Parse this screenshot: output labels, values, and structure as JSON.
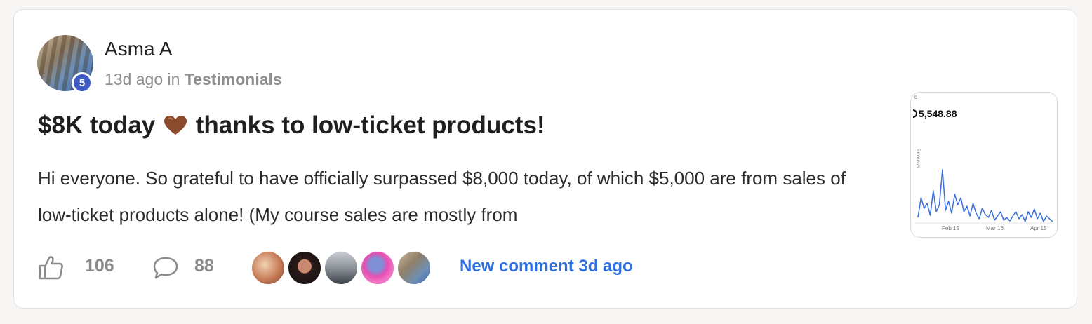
{
  "post": {
    "author": {
      "name": "Asma A",
      "level": "5",
      "icon": "avatar-photo"
    },
    "meta": {
      "time": "13d ago",
      "in": "in",
      "category": "Testimonials"
    },
    "title": {
      "before": "$8K today",
      "emoji": "brown-heart-icon",
      "after": "thanks to low-ticket products!"
    },
    "body": "Hi everyone. So grateful to have officially surpassed $8,000 today, of which $5,000 are from sales of low-ticket products alone! (My course sales are mostly from",
    "attachment": {
      "value_label": "5,548.88",
      "top_label": "e",
      "y_axis_label": "Revenue",
      "x_ticks": [
        "Feb 15",
        "Mar 16",
        "Apr 15"
      ]
    }
  },
  "footer": {
    "likes": "106",
    "comments": "88",
    "commenter_avatars": [
      "avatar-1",
      "avatar-2",
      "avatar-3",
      "avatar-4",
      "avatar-5"
    ],
    "last_activity": "New comment 3d ago"
  },
  "colors": {
    "accent_link": "#2f6fe0",
    "level_badge": "#3f5bc4",
    "muted_text": "#8e8e8e",
    "heart": "#8b4a2b",
    "chart_line": "#3a6fdc"
  }
}
